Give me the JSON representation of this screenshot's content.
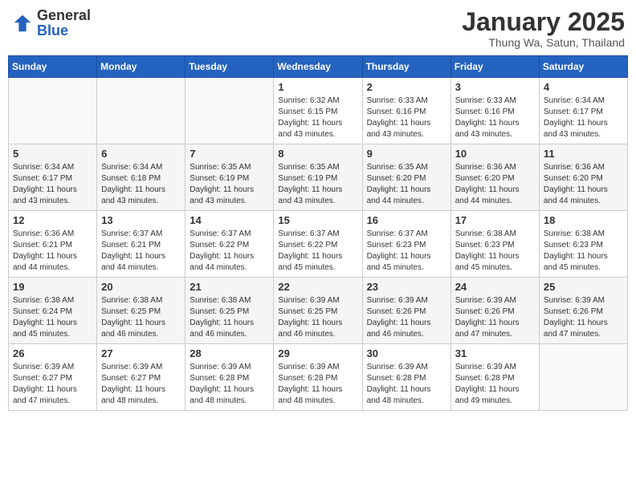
{
  "header": {
    "logo_general": "General",
    "logo_blue": "Blue",
    "title": "January 2025",
    "subtitle": "Thung Wa, Satun, Thailand"
  },
  "weekdays": [
    "Sunday",
    "Monday",
    "Tuesday",
    "Wednesday",
    "Thursday",
    "Friday",
    "Saturday"
  ],
  "weeks": [
    [
      {
        "day": "",
        "info": ""
      },
      {
        "day": "",
        "info": ""
      },
      {
        "day": "",
        "info": ""
      },
      {
        "day": "1",
        "info": "Sunrise: 6:32 AM\nSunset: 6:15 PM\nDaylight: 11 hours\nand 43 minutes."
      },
      {
        "day": "2",
        "info": "Sunrise: 6:33 AM\nSunset: 6:16 PM\nDaylight: 11 hours\nand 43 minutes."
      },
      {
        "day": "3",
        "info": "Sunrise: 6:33 AM\nSunset: 6:16 PM\nDaylight: 11 hours\nand 43 minutes."
      },
      {
        "day": "4",
        "info": "Sunrise: 6:34 AM\nSunset: 6:17 PM\nDaylight: 11 hours\nand 43 minutes."
      }
    ],
    [
      {
        "day": "5",
        "info": "Sunrise: 6:34 AM\nSunset: 6:17 PM\nDaylight: 11 hours\nand 43 minutes."
      },
      {
        "day": "6",
        "info": "Sunrise: 6:34 AM\nSunset: 6:18 PM\nDaylight: 11 hours\nand 43 minutes."
      },
      {
        "day": "7",
        "info": "Sunrise: 6:35 AM\nSunset: 6:19 PM\nDaylight: 11 hours\nand 43 minutes."
      },
      {
        "day": "8",
        "info": "Sunrise: 6:35 AM\nSunset: 6:19 PM\nDaylight: 11 hours\nand 43 minutes."
      },
      {
        "day": "9",
        "info": "Sunrise: 6:35 AM\nSunset: 6:20 PM\nDaylight: 11 hours\nand 44 minutes."
      },
      {
        "day": "10",
        "info": "Sunrise: 6:36 AM\nSunset: 6:20 PM\nDaylight: 11 hours\nand 44 minutes."
      },
      {
        "day": "11",
        "info": "Sunrise: 6:36 AM\nSunset: 6:20 PM\nDaylight: 11 hours\nand 44 minutes."
      }
    ],
    [
      {
        "day": "12",
        "info": "Sunrise: 6:36 AM\nSunset: 6:21 PM\nDaylight: 11 hours\nand 44 minutes."
      },
      {
        "day": "13",
        "info": "Sunrise: 6:37 AM\nSunset: 6:21 PM\nDaylight: 11 hours\nand 44 minutes."
      },
      {
        "day": "14",
        "info": "Sunrise: 6:37 AM\nSunset: 6:22 PM\nDaylight: 11 hours\nand 44 minutes."
      },
      {
        "day": "15",
        "info": "Sunrise: 6:37 AM\nSunset: 6:22 PM\nDaylight: 11 hours\nand 45 minutes."
      },
      {
        "day": "16",
        "info": "Sunrise: 6:37 AM\nSunset: 6:23 PM\nDaylight: 11 hours\nand 45 minutes."
      },
      {
        "day": "17",
        "info": "Sunrise: 6:38 AM\nSunset: 6:23 PM\nDaylight: 11 hours\nand 45 minutes."
      },
      {
        "day": "18",
        "info": "Sunrise: 6:38 AM\nSunset: 6:23 PM\nDaylight: 11 hours\nand 45 minutes."
      }
    ],
    [
      {
        "day": "19",
        "info": "Sunrise: 6:38 AM\nSunset: 6:24 PM\nDaylight: 11 hours\nand 45 minutes."
      },
      {
        "day": "20",
        "info": "Sunrise: 6:38 AM\nSunset: 6:25 PM\nDaylight: 11 hours\nand 46 minutes."
      },
      {
        "day": "21",
        "info": "Sunrise: 6:38 AM\nSunset: 6:25 PM\nDaylight: 11 hours\nand 46 minutes."
      },
      {
        "day": "22",
        "info": "Sunrise: 6:39 AM\nSunset: 6:25 PM\nDaylight: 11 hours\nand 46 minutes."
      },
      {
        "day": "23",
        "info": "Sunrise: 6:39 AM\nSunset: 6:26 PM\nDaylight: 11 hours\nand 46 minutes."
      },
      {
        "day": "24",
        "info": "Sunrise: 6:39 AM\nSunset: 6:26 PM\nDaylight: 11 hours\nand 47 minutes."
      },
      {
        "day": "25",
        "info": "Sunrise: 6:39 AM\nSunset: 6:26 PM\nDaylight: 11 hours\nand 47 minutes."
      }
    ],
    [
      {
        "day": "26",
        "info": "Sunrise: 6:39 AM\nSunset: 6:27 PM\nDaylight: 11 hours\nand 47 minutes."
      },
      {
        "day": "27",
        "info": "Sunrise: 6:39 AM\nSunset: 6:27 PM\nDaylight: 11 hours\nand 48 minutes."
      },
      {
        "day": "28",
        "info": "Sunrise: 6:39 AM\nSunset: 6:28 PM\nDaylight: 11 hours\nand 48 minutes."
      },
      {
        "day": "29",
        "info": "Sunrise: 6:39 AM\nSunset: 6:28 PM\nDaylight: 11 hours\nand 48 minutes."
      },
      {
        "day": "30",
        "info": "Sunrise: 6:39 AM\nSunset: 6:28 PM\nDaylight: 11 hours\nand 48 minutes."
      },
      {
        "day": "31",
        "info": "Sunrise: 6:39 AM\nSunset: 6:28 PM\nDaylight: 11 hours\nand 49 minutes."
      },
      {
        "day": "",
        "info": ""
      }
    ]
  ]
}
